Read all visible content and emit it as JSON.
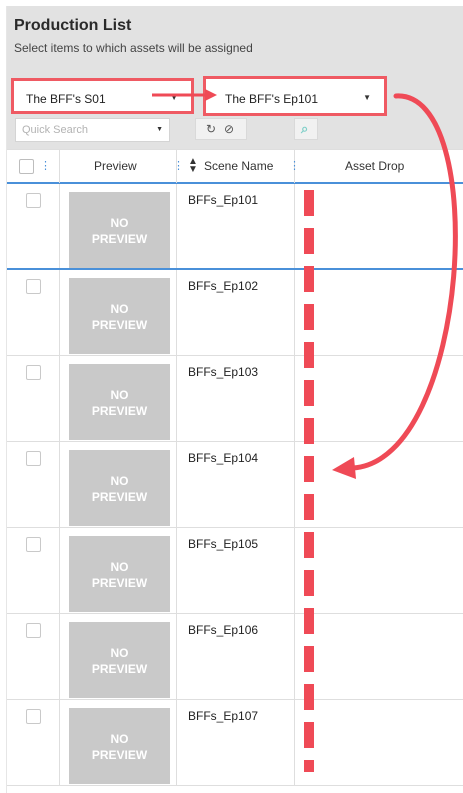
{
  "header": {
    "title": "Production List",
    "subtitle": "Select items to which assets will be assigned"
  },
  "filters": {
    "project": {
      "value": "The BFF's S01"
    },
    "episode": {
      "value": "The BFF's Ep101"
    },
    "search": {
      "placeholder": "Quick Search"
    }
  },
  "table": {
    "columns": {
      "preview": "Preview",
      "scene_name": "Scene Name",
      "asset_drop": "Asset Drop"
    },
    "rows": [
      {
        "scene": "BFFs_Ep101",
        "preview_line1": "NO",
        "preview_line2": "PREVIEW"
      },
      {
        "scene": "BFFs_Ep102",
        "preview_line1": "NO",
        "preview_line2": "PREVIEW"
      },
      {
        "scene": "BFFs_Ep103",
        "preview_line1": "NO",
        "preview_line2": "PREVIEW"
      },
      {
        "scene": "BFFs_Ep104",
        "preview_line1": "NO",
        "preview_line2": "PREVIEW"
      },
      {
        "scene": "BFFs_Ep105",
        "preview_line1": "NO",
        "preview_line2": "PREVIEW"
      },
      {
        "scene": "BFFs_Ep106",
        "preview_line1": "NO",
        "preview_line2": "PREVIEW"
      },
      {
        "scene": "BFFs_Ep107",
        "preview_line1": "NO",
        "preview_line2": "PREVIEW"
      }
    ]
  },
  "colors": {
    "annotation": "#ef4a56",
    "header_bg": "#e2e2e2",
    "selection": "#4a90d9",
    "thumb_bg": "#c9c9c9"
  },
  "icons": [
    "chevron-down-icon",
    "refresh-icon",
    "clear-filter-icon",
    "bulk-select-icon",
    "sort-icon",
    "column-grip-icon",
    "arrow-right-icon",
    "curved-arrow-icon"
  ]
}
